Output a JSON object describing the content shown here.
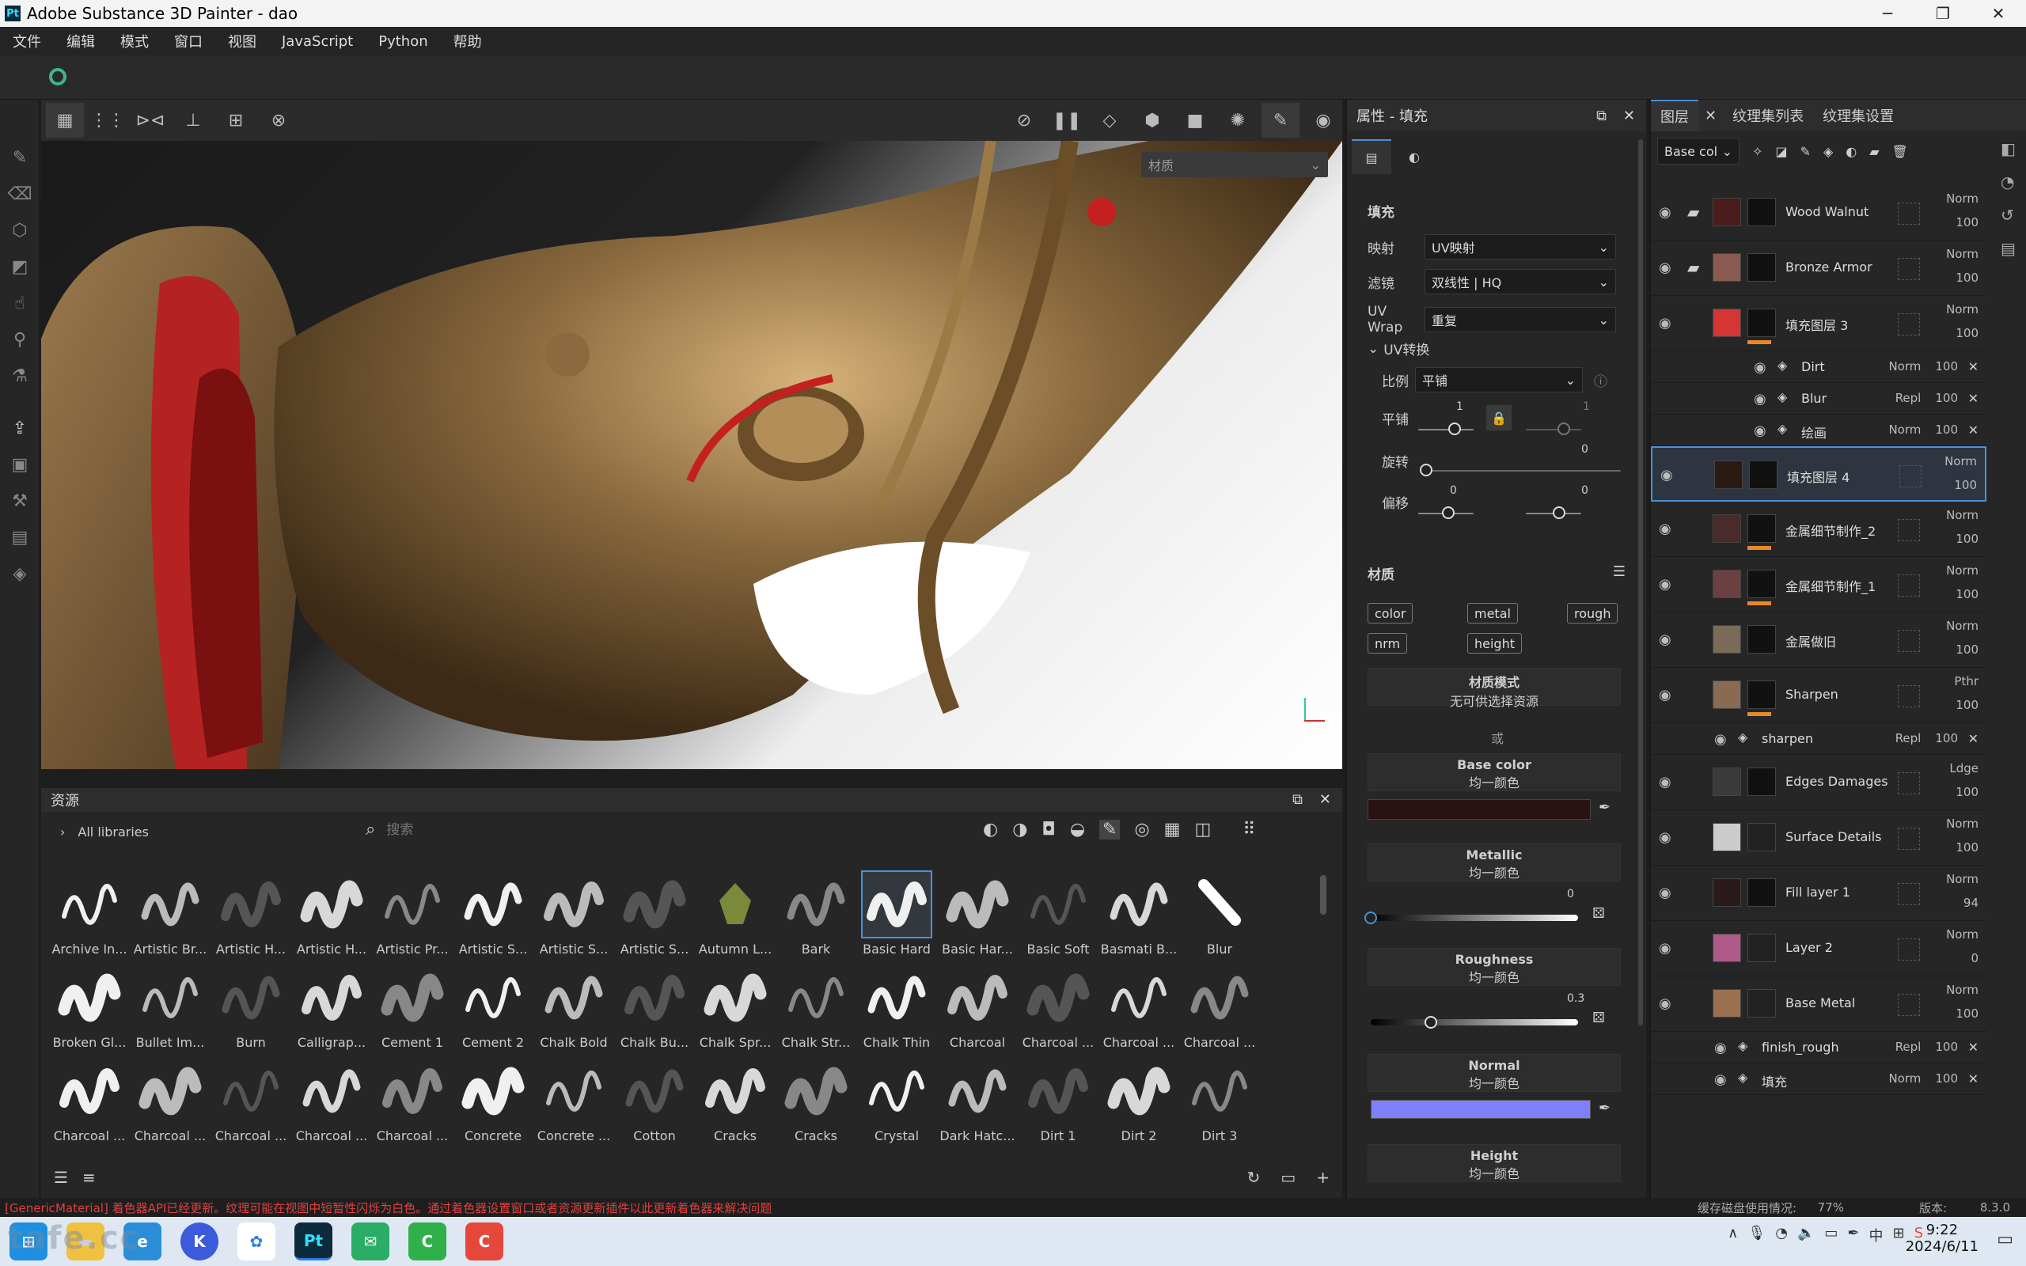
{
  "titlebar": {
    "title": "Adobe Substance 3D Painter - dao",
    "logo": "Pt"
  },
  "menu": [
    "文件",
    "编辑",
    "模式",
    "窗口",
    "视图",
    "JavaScript",
    "Python",
    "帮助"
  ],
  "viewport": {
    "material_dropdown": "材质"
  },
  "assets": {
    "title": "资源",
    "breadcrumb": "All libraries",
    "search_placeholder": "搜索",
    "items": [
      "Archive In...",
      "Artistic Br...",
      "Artistic H...",
      "Artistic H...",
      "Artistic Pr...",
      "Artistic S...",
      "Artistic S...",
      "Artistic S...",
      "Autumn L...",
      "Bark",
      "Basic Hard",
      "Basic Har...",
      "Basic Soft",
      "Basmati B...",
      "Blur",
      "Broken Gl...",
      "Bullet Im...",
      "Burn",
      "Calligrap...",
      "Cement 1",
      "Cement 2",
      "Chalk Bold",
      "Chalk Bu...",
      "Chalk Spr...",
      "Chalk Str...",
      "Chalk Thin",
      "Charcoal",
      "Charcoal ...",
      "Charcoal ...",
      "Charcoal ...",
      "Charcoal ...",
      "Charcoal ...",
      "Charcoal ...",
      "Charcoal ...",
      "Charcoal ...",
      "Concrete",
      "Concrete ...",
      "Cotton",
      "Cracks",
      "Cracks",
      "Crystal",
      "Dark Hatc...",
      "Dirt 1",
      "Dirt 2",
      "Dirt 3"
    ],
    "selected": "Basic Hard"
  },
  "props": {
    "title": "属性 - 填充",
    "section_fill": "填充",
    "mapping_label": "映射",
    "mapping_value": "UV映射",
    "filter_label": "滤镜",
    "filter_value": "双线性 | HQ",
    "uvwrap_label": "UV Wrap",
    "uvwrap_value": "重复",
    "uvtransform": "UV转换",
    "scale_label": "比例",
    "scale_value": "平铺",
    "tile_label": "平铺",
    "tile_v1": "1",
    "tile_v2": "1",
    "rotate_label": "旋转",
    "rotate_value": "0",
    "offset_label": "偏移",
    "offset_v1": "0",
    "offset_v2": "0",
    "material_section": "材质",
    "channels": [
      "color",
      "metal",
      "rough",
      "nrm",
      "height"
    ],
    "matmode_title": "材质模式",
    "matmode_sub": "无可供选择资源",
    "or": "或",
    "base_color_title": "Base color",
    "base_color_sub": "均一颜色",
    "metallic_title": "Metallic",
    "metallic_sub": "均一颜色",
    "metallic_value": "0",
    "roughness_title": "Roughness",
    "roughness_sub": "均一颜色",
    "roughness_value": "0.3",
    "normal_title": "Normal",
    "normal_sub": "均一颜色",
    "height_title": "Height",
    "height_sub": "均一颜色"
  },
  "layers": {
    "tabs": [
      "图层",
      "纹理集列表",
      "纹理集设置"
    ],
    "channel_select": "Base col",
    "rows": [
      {
        "name": "Wood Walnut",
        "blend": "Norm",
        "opacity": "100"
      },
      {
        "name": "Bronze Armor",
        "blend": "Norm",
        "opacity": "100"
      },
      {
        "name": "填充图层 3",
        "blend": "Norm",
        "opacity": "100"
      },
      {
        "name": "Dirt",
        "blend": "Norm",
        "opacity": "100"
      },
      {
        "name": "Blur",
        "blend": "Repl",
        "opacity": "100"
      },
      {
        "name": "绘画",
        "blend": "Norm",
        "opacity": "100"
      },
      {
        "name": "填充图层 4",
        "blend": "Norm",
        "opacity": "100"
      },
      {
        "name": "金属细节制作_2",
        "blend": "Norm",
        "opacity": "100"
      },
      {
        "name": "金属细节制作_1",
        "blend": "Norm",
        "opacity": "100"
      },
      {
        "name": "金属做旧",
        "blend": "Norm",
        "opacity": "100"
      },
      {
        "name": "Sharpen",
        "blend": "Pthr",
        "opacity": "100"
      },
      {
        "name": "sharpen",
        "blend": "Repl",
        "opacity": "100"
      },
      {
        "name": "Edges Damages",
        "blend": "Ldge",
        "opacity": "100"
      },
      {
        "name": "Surface Details",
        "blend": "Norm",
        "opacity": "100"
      },
      {
        "name": "Fill layer 1",
        "blend": "Norm",
        "opacity": "94"
      },
      {
        "name": "Layer 2",
        "blend": "Norm",
        "opacity": "0"
      },
      {
        "name": "Base Metal",
        "blend": "Norm",
        "opacity": "100"
      },
      {
        "name": "finish_rough",
        "blend": "Repl",
        "opacity": "100"
      },
      {
        "name": "填充",
        "blend": "Norm",
        "opacity": "100"
      }
    ]
  },
  "status": {
    "message": "[GenericMaterial] 着色器API已经更新。纹理可能在视图中短暂性闪烁为白色。通过着色器设置窗口或者资源更新插件以此更新着色器来解决问题",
    "cache_label": "缓存磁盘使用情况:",
    "cache_value": "77%",
    "version_label": "版本:",
    "version_value": "8.3.0"
  },
  "taskbar": {
    "time": "9:22",
    "date": "2024/6/11",
    "ime": "中",
    "watermark": "tafe.cc"
  },
  "colors": {
    "accent": "#4a90d9",
    "normal": "#8080ff",
    "base_color": "#2a1212",
    "orange": "#e8892a"
  }
}
